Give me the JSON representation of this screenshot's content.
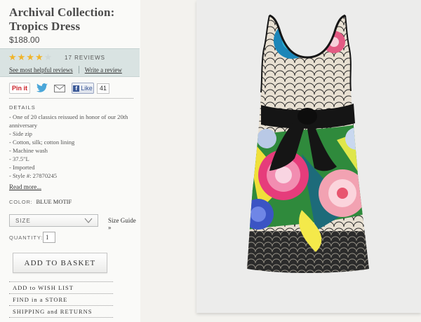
{
  "product": {
    "title": "Archival Collection: Tropics Dress",
    "price": "$188.00"
  },
  "reviews": {
    "rating": 4,
    "max_rating": 5,
    "count_label": "17 REVIEWS",
    "helpful_link": "See most helpful reviews",
    "write_link": "Write a review"
  },
  "social": {
    "pinit_label": "Pin it",
    "fb_like_label": "Like",
    "fb_like_count": "41"
  },
  "details": {
    "heading": "DETAILS",
    "items": [
      "- One of 20 classics reissued in honor of our 20th anniversary",
      "- Side zip",
      "- Cotton, silk; cotton lining",
      "- Machine wash",
      "- 37.5\"L",
      "- Imported",
      "- Style #: 27870245"
    ],
    "read_more": "Read more..."
  },
  "options": {
    "color_label": "COLOR:",
    "color_value": "BLUE MOTIF",
    "size_placeholder": "SIZE",
    "size_guide": "Size Guide »",
    "quantity_label": "QUANTITY:",
    "quantity_value": "1"
  },
  "actions": {
    "add_to_basket": "ADD TO BASKET",
    "wish_list": "ADD to WISH LIST",
    "find_store": "FIND in a STORE",
    "shipping": "SHIPPING and RETURNS"
  },
  "colors": {
    "review_band": "#d9e3e2",
    "star_on": "#f0b42a",
    "sash": "#151515"
  }
}
